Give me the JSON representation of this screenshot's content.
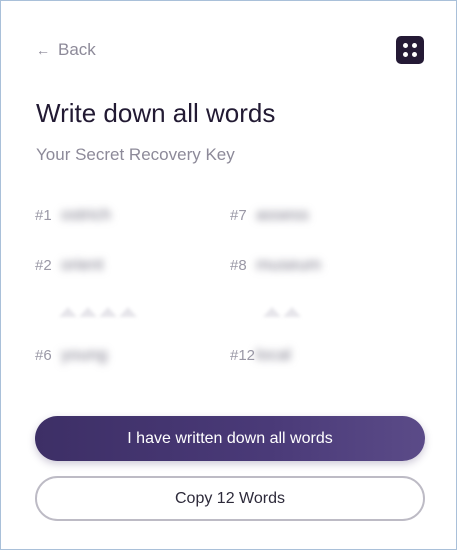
{
  "nav": {
    "back_label": "Back",
    "back_arrow": "←",
    "menu_icon": "grid-dots-icon"
  },
  "header": {
    "title": "Write down all words",
    "subtitle": "Your Secret Recovery Key"
  },
  "words": [
    {
      "num": "#1",
      "word": "ostrich"
    },
    {
      "num": "#7",
      "word": "assess"
    },
    {
      "num": "#2",
      "word": "orient"
    },
    {
      "num": "#8",
      "word": "museum"
    },
    {
      "num": "#6",
      "word": "young"
    },
    {
      "num": "#12",
      "word": "local"
    }
  ],
  "actions": {
    "confirm_label": "I have written down all words",
    "copy_label": "Copy 12 Words"
  },
  "colors": {
    "primary": "#3d2f66",
    "text_dark": "#221a33",
    "text_muted": "#8d8a99"
  }
}
